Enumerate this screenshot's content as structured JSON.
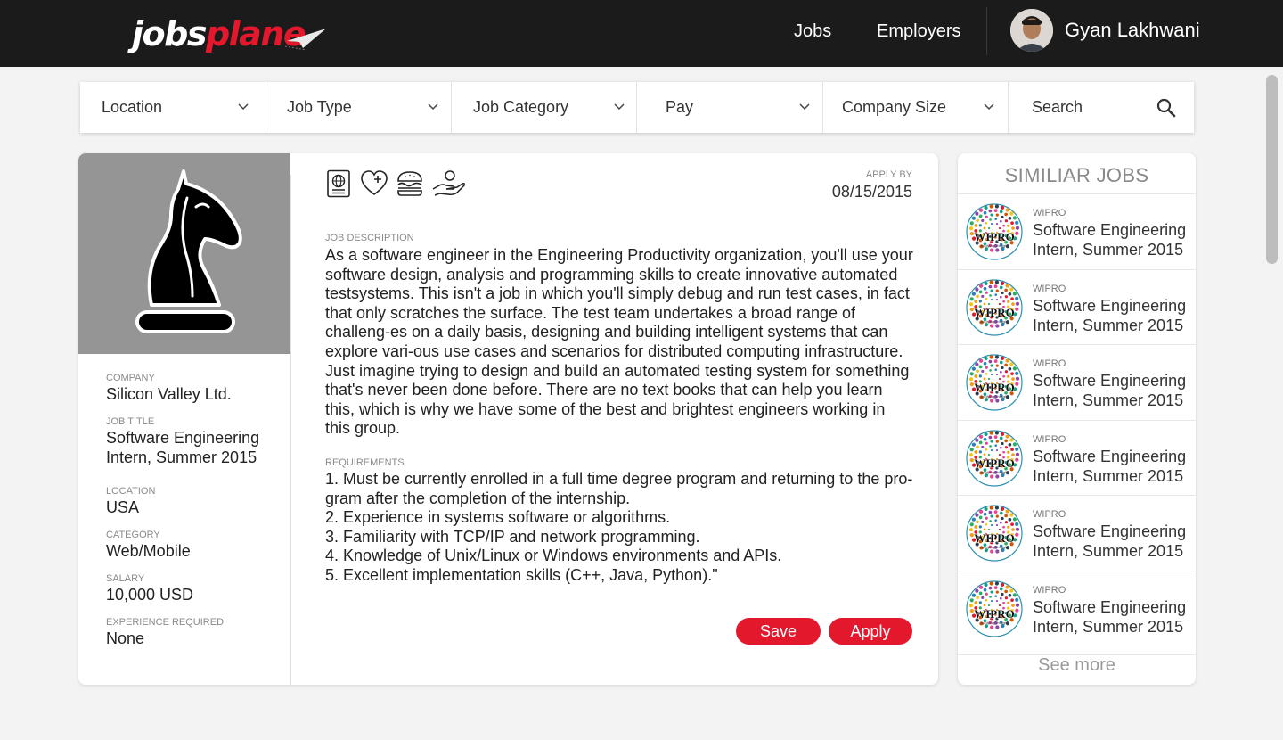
{
  "brand": {
    "logo_part1": "jobs",
    "logo_part2": "plane",
    "accent": "#e3182d"
  },
  "nav": {
    "links": [
      {
        "label": "Jobs"
      },
      {
        "label": "Employers"
      }
    ],
    "user": {
      "name": "Gyan Lakhwani"
    }
  },
  "filters": [
    {
      "label": "Location"
    },
    {
      "label": "Job Type"
    },
    {
      "label": "Job Category"
    },
    {
      "label": "Pay"
    },
    {
      "label": "Company Size"
    }
  ],
  "search": {
    "label": "Search"
  },
  "job": {
    "company_label": "COMPANY",
    "company": "Silicon Valley Ltd.",
    "title_label": "JOB TITLE",
    "title": "Software Engineering Intern, Summer 2015",
    "location_label": "LOCATION",
    "location": "USA",
    "category_label": "CATEGORY",
    "category": "Web/Mobile",
    "salary_label": "SALARY",
    "salary": "10,000 USD",
    "experience_label": "EXPERIENCE REQUIRED",
    "experience": "None",
    "apply_by_label": "APPLY BY",
    "apply_by": "08/15/2015",
    "perk_icons": [
      "passport-icon",
      "health-heart-icon",
      "burger-icon",
      "hand-giving-icon"
    ],
    "description_label": "JOB DESCRIPTION",
    "description": "As a software engineer in the Engineering Productivity organization, you'll use your software design, analysis and programming skills to create innovative automated testsystems. This isn't a job in which you'll simply debug and run test cases, in fact that only scratches the surface. The test team undertakes a broad range of challeng-es on a daily basis, designing and building intelligent systems that can explore vari-ous use cases and scenarios for distributed computing infrastructure. Just imagine trying to design and build an automated testing system for something that's never been done before. There are no text books that can help you learn this, which is why we have some of the best and brightest engineers working in this group.",
    "requirements_label": "REQUIREMENTS",
    "requirements": [
      "1. Must be currently enrolled in a full time degree program and returning to the pro-gram after the completion of the internship.",
      "2. Experience in systems software or algorithms.",
      "3. Familiarity with TCP/IP and network programming.",
      "4. Knowledge of Unix/Linux or Windows environments and APIs.",
      "5. Excellent implementation skills (C++, Java, Python).\""
    ],
    "save_label": "Save",
    "apply_label": "Apply"
  },
  "similar": {
    "title": "SIMILIAR JOBS",
    "items": [
      {
        "company": "WIPRO",
        "title": "Software Engineering Intern, Summer 2015"
      },
      {
        "company": "WIPRO",
        "title": "Software Engineering Intern, Summer 2015"
      },
      {
        "company": "WIPRO",
        "title": "Software Engineering Intern, Summer 2015"
      },
      {
        "company": "WIPRO",
        "title": "Software Engineering Intern, Summer 2015"
      },
      {
        "company": "WIPRO",
        "title": "Software Engineering Intern, Summer 2015"
      },
      {
        "company": "WIPRO",
        "title": "Software Engineering Intern, Summer 2015"
      }
    ],
    "logo_text": "WIPRO",
    "logo_tagline": "Applying Thought",
    "see_more": "See more"
  }
}
